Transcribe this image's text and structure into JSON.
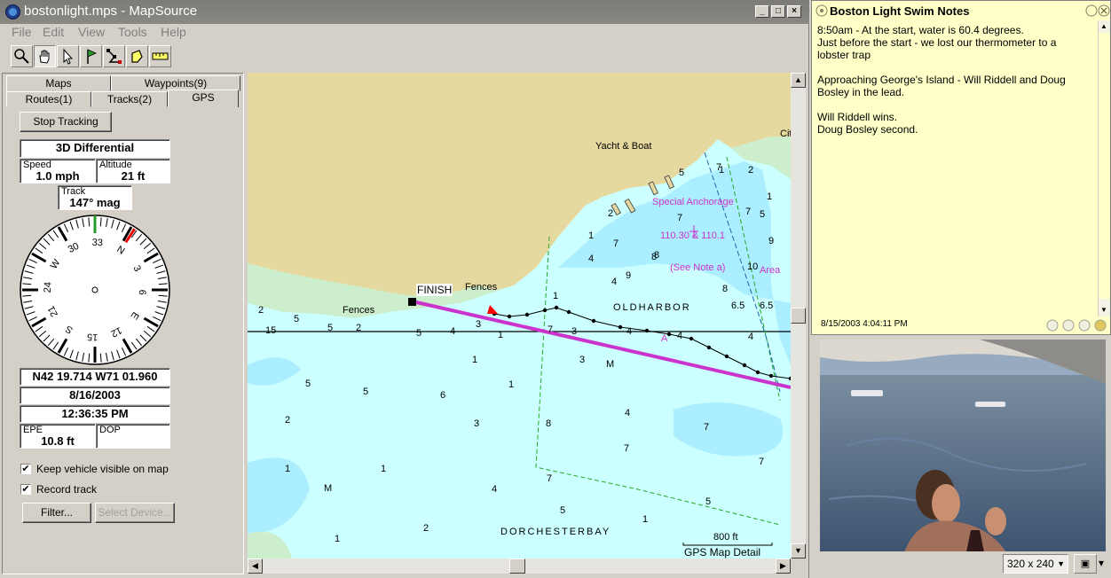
{
  "main_window": {
    "title": "bostonlight.mps - MapSource",
    "menu": [
      "File",
      "Edit",
      "View",
      "Tools",
      "Help"
    ],
    "toolbar": [
      "zoom-tool",
      "hand-tool",
      "select-tool",
      "waypoint-tool",
      "route-tool",
      "area-tool",
      "measure-tool"
    ]
  },
  "left_panel": {
    "tabs_row1": [
      "Maps",
      "Waypoints(9)"
    ],
    "tabs_row2": [
      "Routes(1)",
      "Tracks(2)",
      "GPS"
    ],
    "selected_tab": "GPS",
    "stop_tracking_label": "Stop Tracking",
    "fix_status": "3D Differential",
    "speed_label": "Speed",
    "speed_value": "1.0 mph",
    "altitude_label": "Altitude",
    "altitude_value": "21 ft",
    "track_label": "Track",
    "track_value": "147° mag",
    "compass_labels": [
      "3",
      "6",
      "W",
      "30",
      "33",
      "N",
      "3",
      "6",
      "E",
      "12",
      "15",
      "S",
      "21",
      "24"
    ],
    "compass_heading_deg": 147,
    "position": "N42 19.714 W71 01.960",
    "date": "8/16/2003",
    "time": "12:36:35 PM",
    "epe_label": "EPE",
    "epe_value": "10.8 ft",
    "dop_label": "DOP",
    "dop_value": "",
    "keep_visible_label": "Keep vehicle visible on map",
    "keep_visible_checked": true,
    "record_track_label": "Record track",
    "record_track_checked": true,
    "filter_label": "Filter...",
    "select_device_label": "Select Device..."
  },
  "map": {
    "place_labels": {
      "yacht": "Yacht & Boat",
      "city": "Cit",
      "finish": "FINISH",
      "fences1": "Fences",
      "fences2": "Fences",
      "special_anchorage": "Special Anchorage",
      "freq": "110.30 & 110.1",
      "see_note": "(See Note a)",
      "area": "Area",
      "old_harbor": "OLDHARBOR",
      "dorchester_bay": "DORCHESTERBAY",
      "marker_a": "A",
      "m1": "M",
      "m2": "M"
    },
    "scale_label": "800 ft",
    "detail_label": "GPS Map Detail",
    "depths": [
      "2",
      "5",
      "Fences",
      "15",
      "5",
      "2",
      "5",
      "4",
      "3",
      "1",
      "7",
      "3",
      "1",
      "3",
      "4",
      "5",
      "5",
      "6",
      "1",
      "2",
      "3",
      "8",
      "7",
      "7",
      "7",
      "5",
      "7",
      "4",
      "4",
      "1",
      "1",
      "M",
      "1",
      "4",
      "2",
      "1",
      "5",
      "4",
      "1",
      "7",
      "8",
      "9",
      "8",
      "8",
      "6.5",
      "6.5",
      "10",
      "9",
      "7",
      "7",
      "1",
      "4",
      "4",
      "2",
      "5",
      "7",
      "1",
      "2",
      "1",
      "5"
    ]
  },
  "notes_window": {
    "title": "Boston Light Swim Notes",
    "text": "8:50am - At the start, water is 60.4 degrees.\nJust before the start - we lost our thermometer to a lobster trap\n\nApproaching George's Island - Will Riddell and Doug Bosley in the lead.\n\nWill Riddell wins.\nDoug Bosley second.",
    "timestamp": "8/15/2003 4:04:11 PM"
  },
  "video_window": {
    "size_label": "320 x 240"
  },
  "colors": {
    "land": "#e6d9a0",
    "water": "#ccffff",
    "shallow": "#aaeeff",
    "marsh": "#cceecc",
    "track": "#cc33cc",
    "note_bg": "#ffffc8"
  }
}
